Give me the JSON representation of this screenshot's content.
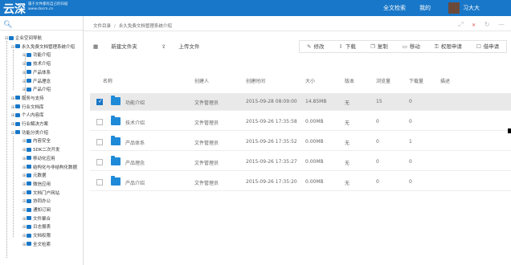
{
  "header": {
    "logo": "云深",
    "slogan_line1": "属于文件都有自己的归宿",
    "slogan_line2": "www.docm.cn",
    "nav_search": "全文检索",
    "nav_mine": "我的",
    "username": "习大大",
    "bg_color": "#1877c8"
  },
  "sidebar": {
    "search_icon": "search-icon",
    "items": [
      {
        "label": "企业空间导航",
        "level": 0,
        "exp": "⊟"
      },
      {
        "label": "永久免费文档管理系统介绍",
        "level": 1,
        "exp": "⊟"
      },
      {
        "label": "功能介绍",
        "level": 2,
        "exp": "⊞"
      },
      {
        "label": "技术介绍",
        "level": 2,
        "exp": "⊞"
      },
      {
        "label": "产品体系",
        "level": 2,
        "exp": "⊞"
      },
      {
        "label": "产品理念",
        "level": 2,
        "exp": "⊞"
      },
      {
        "label": "产品介绍",
        "level": 2,
        "exp": "⊞"
      },
      {
        "label": "服务与支持",
        "level": 1,
        "exp": "⊞"
      },
      {
        "label": "行业文档库",
        "level": 1,
        "exp": "⊞"
      },
      {
        "label": "个人内容库",
        "level": 1,
        "exp": "⊞"
      },
      {
        "label": "行业解决方案",
        "level": 1,
        "exp": "⊞"
      },
      {
        "label": "功能分类介绍",
        "level": 1,
        "exp": "⊟"
      },
      {
        "label": "内容安全",
        "level": 2,
        "exp": "⊞"
      },
      {
        "label": "SDK二次开发",
        "level": 2,
        "exp": "⊞"
      },
      {
        "label": "移动化应用",
        "level": 2,
        "exp": "⊞"
      },
      {
        "label": "结构化与非结构化数据",
        "level": 2,
        "exp": "⊞"
      },
      {
        "label": "元数据",
        "level": 2,
        "exp": "⊞"
      },
      {
        "label": "微信应用",
        "level": 2,
        "exp": "⊞"
      },
      {
        "label": "文档门户网站",
        "level": 2,
        "exp": "⊞"
      },
      {
        "label": "协同办公",
        "level": 2,
        "exp": "⊞"
      },
      {
        "label": "通知订阅",
        "level": 2,
        "exp": "⊞"
      },
      {
        "label": "文件聚合",
        "level": 2,
        "exp": "⊞"
      },
      {
        "label": "日志报表",
        "level": 2,
        "exp": "⊞"
      },
      {
        "label": "文档权限",
        "level": 2,
        "exp": "⊞"
      },
      {
        "label": "全文检索",
        "level": 2,
        "exp": "⊞"
      }
    ]
  },
  "breadcrumb": {
    "root": "文件目录",
    "sep": "/",
    "current": "永久免费文档管理系统介绍"
  },
  "toolbar": {
    "new_folder": "新建文件夹",
    "upload": "上传文件",
    "edit": "修改",
    "download": "下载",
    "copy": "复制",
    "move": "移动",
    "perm_request": "权限申请",
    "borrow_request": "借申请"
  },
  "table": {
    "headers": {
      "name": "名称",
      "creator": "创建人",
      "created": "创建时间",
      "size": "大小",
      "version": "版本",
      "views": "浏览量",
      "downloads": "下载量",
      "desc": "描述"
    },
    "rows": [
      {
        "name": "功能介绍",
        "creator": "文件管理员",
        "created": "2015-09-28 08:09:00",
        "size": "14.85MB",
        "version": "无",
        "views": "15",
        "downloads": "0",
        "selected": true
      },
      {
        "name": "技术介绍",
        "creator": "文件管理员",
        "created": "2015-09-26 17:35:58",
        "size": "0.00MB",
        "version": "无",
        "views": "0",
        "downloads": "0",
        "selected": false
      },
      {
        "name": "产品体系",
        "creator": "文件管理员",
        "created": "2015-09-26 17:35:52",
        "size": "0.00MB",
        "version": "无",
        "views": "0",
        "downloads": "1",
        "selected": false
      },
      {
        "name": "产品理念",
        "creator": "文件管理员",
        "created": "2015-09-26 17:35:27",
        "size": "0.00MB",
        "version": "无",
        "views": "0",
        "downloads": "0",
        "selected": false
      },
      {
        "name": "产品介绍",
        "creator": "文件管理员",
        "created": "2015-09-26 17:35:20",
        "size": "0.00MB",
        "version": "无",
        "views": "0",
        "downloads": "0",
        "selected": false
      }
    ]
  }
}
